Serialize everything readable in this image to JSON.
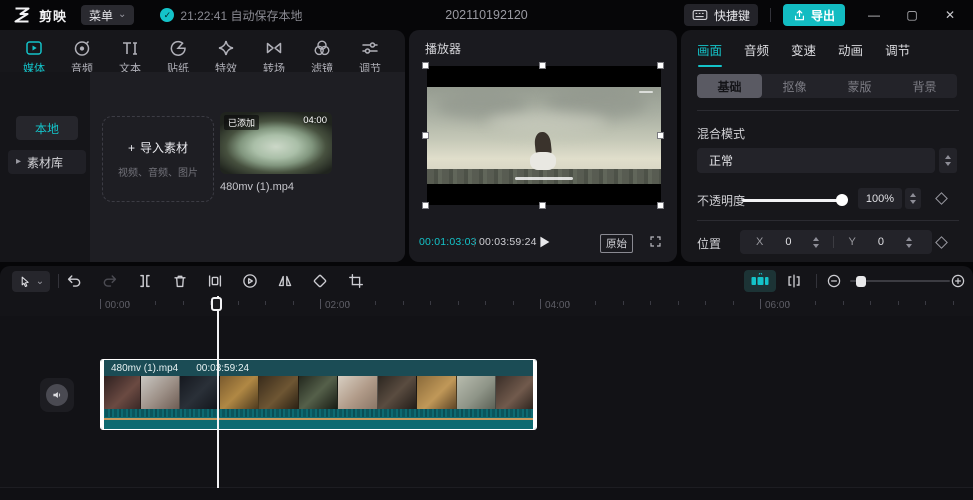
{
  "colors": {
    "accent": "#14c3c9",
    "export_button_bg": "#12bcc2",
    "clip_header_bg": "#1b4c55",
    "waveform_bg": "#0e6a71",
    "waveform_line": "#c9995c"
  },
  "icons": {
    "chevron_down": "⌄",
    "caret_right": "▸",
    "check": "✓",
    "plus": "+",
    "minimize": "—",
    "maximize": "▢",
    "close": "✕",
    "time_separator": "|"
  },
  "titlebar": {
    "app_name": "剪映",
    "menu_label": "菜单",
    "autosave_text": "21:22:41 自动保存本地",
    "project_title": "202110192120",
    "shortcut_label": "快捷键",
    "export_label": "导出"
  },
  "media_panel": {
    "tabs": [
      {
        "label": "媒体"
      },
      {
        "label": "音频"
      },
      {
        "label": "文本"
      },
      {
        "label": "贴纸"
      },
      {
        "label": "特效"
      },
      {
        "label": "转场"
      },
      {
        "label": "滤镜"
      },
      {
        "label": "调节"
      }
    ],
    "active_tab": "媒体",
    "nav": {
      "local": "本地",
      "library": "素材库"
    },
    "import_title": "导入素材",
    "import_subtitle": "视频、音频、图片",
    "media_item": {
      "added_badge": "已添加",
      "duration": "04:00",
      "filename": "480mv (1).mp4"
    }
  },
  "player": {
    "title": "播放器",
    "current_time": "00:01:03:03",
    "total_time": "00:03:59:24",
    "original_label": "原始"
  },
  "inspector": {
    "tabs": [
      {
        "label": "画面"
      },
      {
        "label": "音频"
      },
      {
        "label": "变速"
      },
      {
        "label": "动画"
      },
      {
        "label": "调节"
      }
    ],
    "active_tab": "画面",
    "subtabs": [
      {
        "label": "基础"
      },
      {
        "label": "抠像"
      },
      {
        "label": "蒙版"
      },
      {
        "label": "背景"
      }
    ],
    "active_subtab": "基础",
    "blend_mode": {
      "label": "混合模式",
      "value": "正常"
    },
    "opacity": {
      "label": "不透明度",
      "value": "100%"
    },
    "position": {
      "label": "位置",
      "x_label": "X",
      "x_value": "0",
      "y_label": "Y",
      "y_value": "0"
    }
  },
  "timeline": {
    "ruler_marks": [
      "00:00",
      "02:00",
      "04:00",
      "06:00"
    ],
    "clip": {
      "filename": "480mv (1).mp4",
      "duration": "00:03:59:24"
    }
  }
}
